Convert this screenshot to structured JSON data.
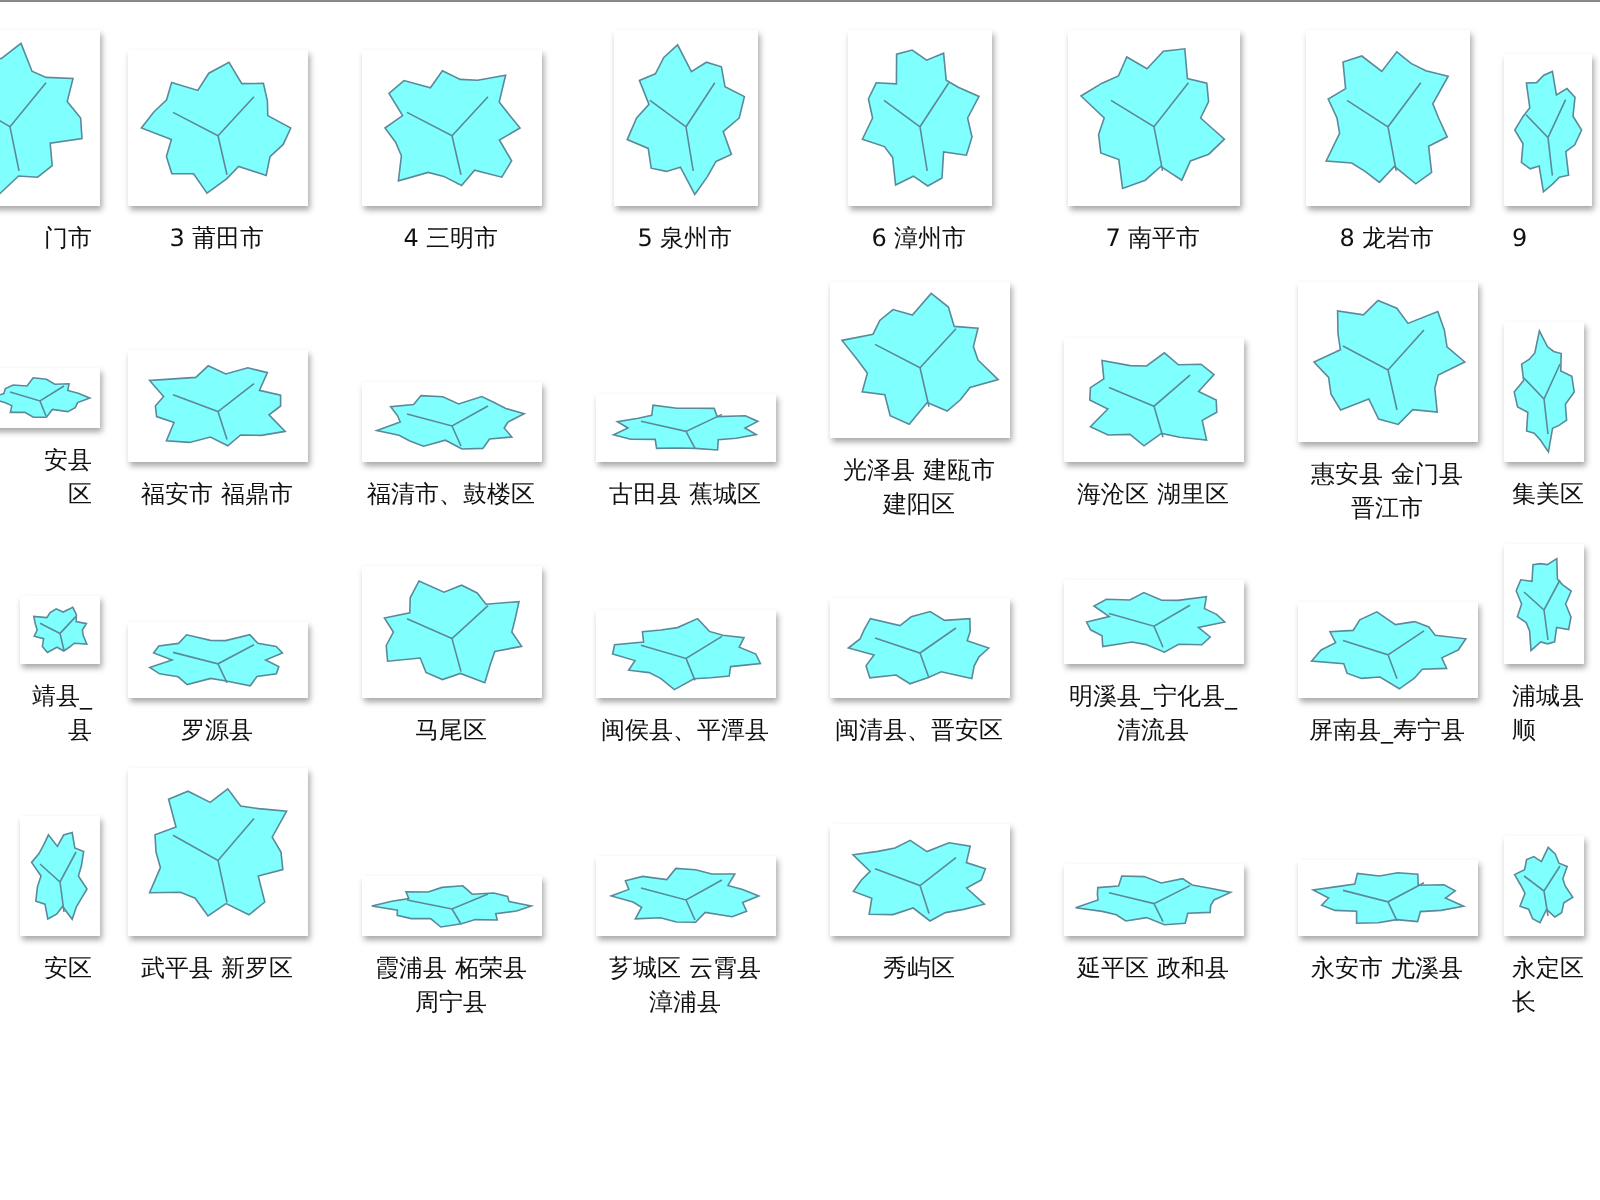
{
  "files": [
    {
      "lines": [
        "门市"
      ]
    },
    {
      "lines": [
        "3 莆田市"
      ]
    },
    {
      "lines": [
        "4 三明市"
      ]
    },
    {
      "lines": [
        "5 泉州市"
      ]
    },
    {
      "lines": [
        "6 漳州市"
      ]
    },
    {
      "lines": [
        "7 南平市"
      ]
    },
    {
      "lines": [
        "8 龙岩市"
      ]
    },
    {
      "lines": [
        "9"
      ]
    },
    {
      "lines": [
        "安县",
        "区"
      ]
    },
    {
      "lines": [
        "福安市 福鼎市"
      ]
    },
    {
      "lines": [
        "福清市、鼓楼区"
      ]
    },
    {
      "lines": [
        "古田县 蕉城区"
      ]
    },
    {
      "lines": [
        "光泽县 建瓯市",
        "建阳区"
      ]
    },
    {
      "lines": [
        "海沧区 湖里区"
      ]
    },
    {
      "lines": [
        "惠安县 金门县",
        "晋江市"
      ]
    },
    {
      "lines": [
        "集美区"
      ]
    },
    {
      "lines": [
        "靖县_",
        "县"
      ]
    },
    {
      "lines": [
        "罗源县"
      ]
    },
    {
      "lines": [
        "马尾区"
      ]
    },
    {
      "lines": [
        "闽侯县、平潭县"
      ]
    },
    {
      "lines": [
        "闽清县、晋安区"
      ]
    },
    {
      "lines": [
        "明溪县_宁化县_",
        "清流县"
      ]
    },
    {
      "lines": [
        "屏南县_寿宁县"
      ]
    },
    {
      "lines": [
        "浦城县",
        "顺"
      ]
    },
    {
      "lines": [
        "安区"
      ]
    },
    {
      "lines": [
        "武平县 新罗区"
      ]
    },
    {
      "lines": [
        "霞浦县 柘荣县",
        "周宁县"
      ]
    },
    {
      "lines": [
        "芗城区 云霄县",
        "漳浦县"
      ]
    },
    {
      "lines": [
        "秀屿区"
      ]
    },
    {
      "lines": [
        "延平区 政和县"
      ]
    },
    {
      "lines": [
        "永安市 尤溪县"
      ]
    },
    {
      "lines": [
        "永定区",
        "长"
      ]
    }
  ]
}
